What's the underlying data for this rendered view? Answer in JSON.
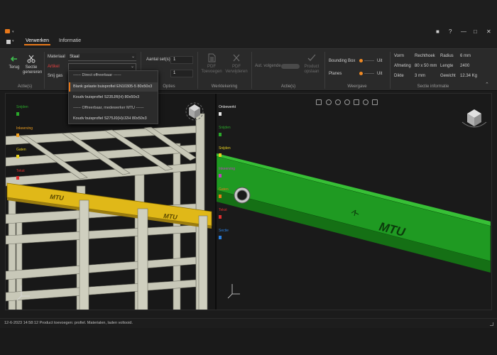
{
  "window": {
    "controls": [
      "■",
      "?",
      "—",
      "□",
      "✕"
    ]
  },
  "tabs": [
    {
      "label": "Verwerken",
      "active": true
    },
    {
      "label": "Informatie",
      "active": false
    }
  ],
  "ribbon": {
    "acties_group": {
      "back_label": "Terug",
      "sectie_label_1": "Sectie",
      "sectie_label_2": "genereren",
      "group_label": "Actie(s)"
    },
    "materiaal": {
      "label": "Materiaal",
      "value": "Staal",
      "artikel_label": "Artikel",
      "snij_label": "Snij gas"
    },
    "opties": {
      "aantal_label": "Aantal set(s)",
      "aantal_value": "1",
      "second_value": "1",
      "group_label": "Opties"
    },
    "werktekening": {
      "pdf_add_1": "PDF",
      "pdf_add_2": "Toevoegen",
      "pdf_remove_1": "PDF",
      "pdf_remove_2": "Verwijderen",
      "group_label": "Werktekening"
    },
    "acties2": {
      "aut_label": "Aut. volgende",
      "product_1": "Product",
      "product_2": "opslaan",
      "group_label": "Actie(s)"
    },
    "weergave": {
      "bbox_label": "Bounding Box",
      "bbox_value": "Uit",
      "planes_label": "Planes",
      "planes_value": "Uit",
      "group_label": "Weergave"
    },
    "sectie_info": {
      "rows": [
        {
          "k1": "Vorm",
          "v1": "Rechthoek",
          "k2": "Radius",
          "v2": "6 mm"
        },
        {
          "k1": "Afmeting",
          "v1": "80 x 50 mm",
          "k2": "Lengte",
          "v2": "2400"
        },
        {
          "k1": "Dikte",
          "v1": "3 mm",
          "k2": "Gewicht",
          "v2": "12.34 Kg"
        }
      ],
      "group_label": "Sectie informatie"
    }
  },
  "artikel_dropdown": {
    "items": [
      {
        "text": "------ Direct offreerbaar ------",
        "type": "header"
      },
      {
        "text": "Blank gelaste buisprofiel EN10305-5 80x50x3",
        "type": "selected"
      },
      {
        "text": "Koudv buisprofiel S235JR(H) 80x50x3",
        "type": "item"
      },
      {
        "text": "------ Offreerbaar, medewerker MTU ------",
        "type": "header"
      },
      {
        "text": "Koudv buisprofiel S275J0(H)/J2H 80x50x3",
        "type": "item"
      }
    ]
  },
  "left_legend": [
    {
      "label": "Snijden",
      "color": "#2aa82a"
    },
    {
      "label": "Inkeerving",
      "color": "#f0a020"
    },
    {
      "label": "Gaten",
      "color": "#e8d020"
    },
    {
      "label": "Tekst",
      "color": "#e03030"
    }
  ],
  "right_legend": [
    {
      "label": "Onbewerkt",
      "color": "#e8e8e8"
    },
    {
      "label": "Snijden",
      "color": "#2aa82a"
    },
    {
      "label": "Snijden",
      "color": "#e8d020"
    },
    {
      "label": "Inkeerving",
      "color": "#c040c0"
    },
    {
      "label": "Gaten",
      "color": "#e8781a"
    },
    {
      "label": "Tekst",
      "color": "#e03030"
    },
    {
      "label": "Sectie",
      "color": "#2a80e0"
    }
  ],
  "beam_text": "MTU",
  "status": {
    "message": "12-6-2023 14:58:12 Product toevoegen: profiel. Materialen, laden voltooid."
  }
}
